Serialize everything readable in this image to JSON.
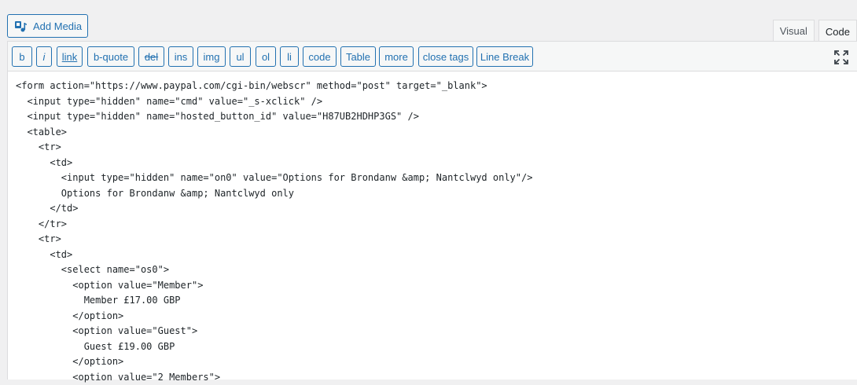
{
  "add_media": {
    "label": "Add Media",
    "icon": "media-icon"
  },
  "tabs": [
    {
      "label": "Visual",
      "active": false
    },
    {
      "label": "Code",
      "active": true
    }
  ],
  "toolbar": {
    "buttons": [
      {
        "label": "b",
        "name": "bold-button"
      },
      {
        "label": "i",
        "name": "italic-button"
      },
      {
        "label": "link",
        "name": "link-button"
      },
      {
        "label": "b-quote",
        "name": "b-quote-button"
      },
      {
        "label": "del",
        "name": "del-button"
      },
      {
        "label": "ins",
        "name": "ins-button"
      },
      {
        "label": "img",
        "name": "img-button"
      },
      {
        "label": "ul",
        "name": "ul-button"
      },
      {
        "label": "ol",
        "name": "ol-button"
      },
      {
        "label": "li",
        "name": "li-button"
      },
      {
        "label": "code",
        "name": "code-button"
      },
      {
        "label": "Table",
        "name": "table-button"
      },
      {
        "label": "more",
        "name": "more-button"
      },
      {
        "label": "close tags",
        "name": "close-tags-button"
      },
      {
        "label": "Line Break",
        "name": "line-break-button"
      }
    ],
    "fullscreen_icon": "fullscreen-icon"
  },
  "code_lines": [
    "<form action=\"https://www.paypal.com/cgi-bin/webscr\" method=\"post\" target=\"_blank\">",
    "  <input type=\"hidden\" name=\"cmd\" value=\"_s-xclick\" />",
    "  <input type=\"hidden\" name=\"hosted_button_id\" value=\"H87UB2HDHP3GS\" />",
    "  <table>",
    "    <tr>",
    "      <td>",
    "        <input type=\"hidden\" name=\"on0\" value=\"Options for Brondanw &amp; Nantclwyd only\"/>",
    "        Options for Brondanw &amp; Nantclwyd only",
    "      </td>",
    "    </tr>",
    "    <tr>",
    "      <td>",
    "        <select name=\"os0\">",
    "          <option value=\"Member\">",
    "            Member £17.00 GBP",
    "          </option>",
    "          <option value=\"Guest\">",
    "            Guest £19.00 GBP",
    "          </option>",
    "          <option value=\"2 Members\">"
  ],
  "colors": {
    "accent": "#2271b1",
    "border": "#dcdcde",
    "background": "#f0f0f1"
  }
}
